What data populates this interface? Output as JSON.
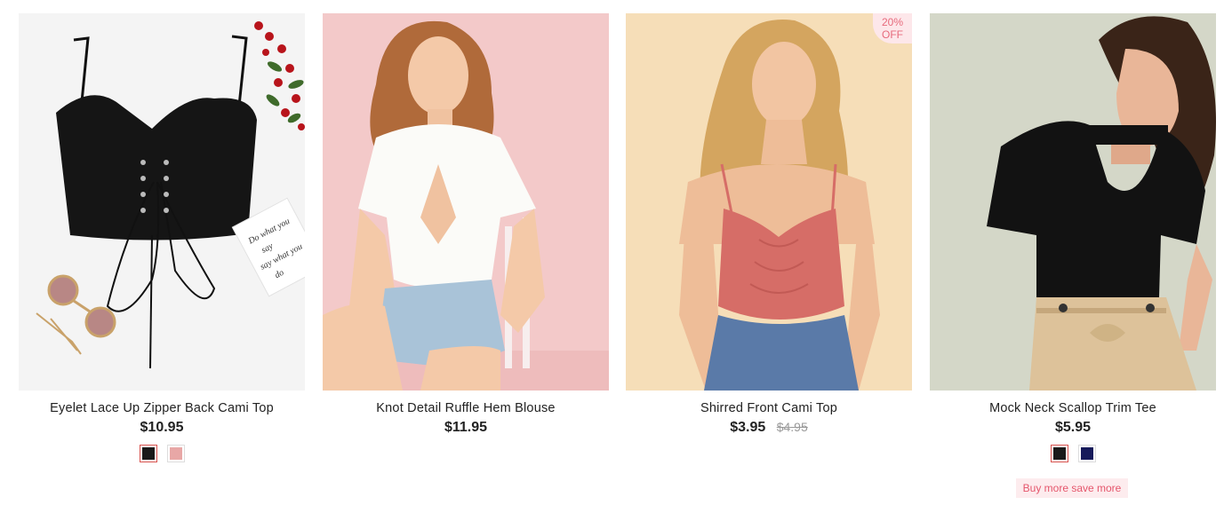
{
  "products": [
    {
      "title": "Eyelet Lace Up Zipper Back Cami Top",
      "price": "$10.95",
      "image": "black-lace-cami-flatlay",
      "swatches": [
        {
          "color": "#1a1a1a",
          "selected": true
        },
        {
          "color": "#e8a7a6",
          "selected": false
        }
      ]
    },
    {
      "title": "Knot Detail Ruffle Hem Blouse",
      "price": "$11.95",
      "image": "white-blouse-model-pink-background",
      "swatches": []
    },
    {
      "title": "Shirred Front Cami Top",
      "price": "$3.95",
      "old_price": "$4.95",
      "badge": {
        "line1": "20%",
        "line2": "OFF"
      },
      "image": "pink-cami-model",
      "swatches": []
    },
    {
      "title": "Mock Neck Scallop Trim Tee",
      "price": "$5.95",
      "image": "black-scallop-tee-model",
      "swatches": [
        {
          "color": "#1a1a1a",
          "selected": true
        },
        {
          "color": "#161a5a",
          "selected": false
        }
      ],
      "promo": "Buy more save more"
    }
  ],
  "colors": {
    "accent": "#e5566c",
    "badge_bg": "#fde7ea",
    "selected_swatch_border": "#d9534f"
  }
}
